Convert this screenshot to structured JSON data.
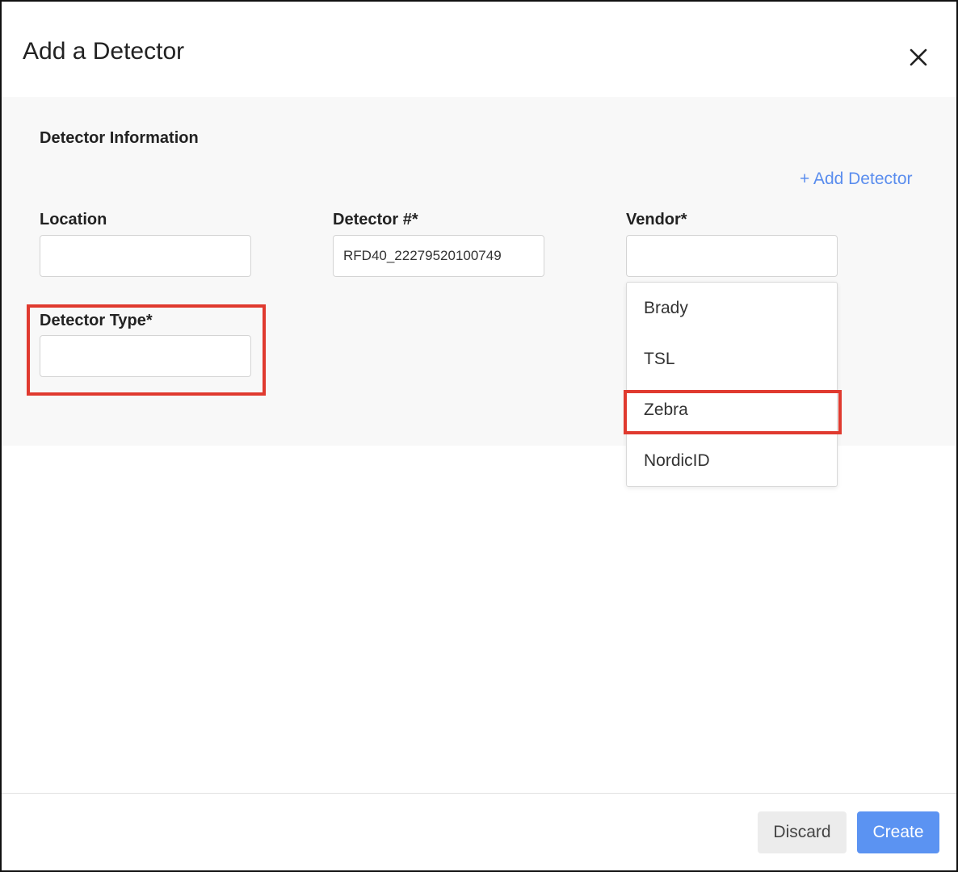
{
  "modal": {
    "title": "Add a Detector",
    "close_icon": "close-icon"
  },
  "section": {
    "title": "Detector Information",
    "add_link": "+ Add Detector"
  },
  "fields": {
    "location": {
      "label": "Location",
      "value": ""
    },
    "detector_number": {
      "label": "Detector #*",
      "value": "RFD40_22279520100749"
    },
    "vendor": {
      "label": "Vendor*",
      "value": ""
    },
    "detector_type": {
      "label": "Detector Type*",
      "value": ""
    }
  },
  "vendor_options": [
    "Brady",
    "TSL",
    "Zebra",
    "NordicID"
  ],
  "footer": {
    "discard_label": "Discard",
    "create_label": "Create"
  },
  "colors": {
    "accent": "#5b93f2",
    "link": "#5a8dee",
    "highlight": "#e03a2f",
    "panel_bg": "#f8f8f8"
  }
}
